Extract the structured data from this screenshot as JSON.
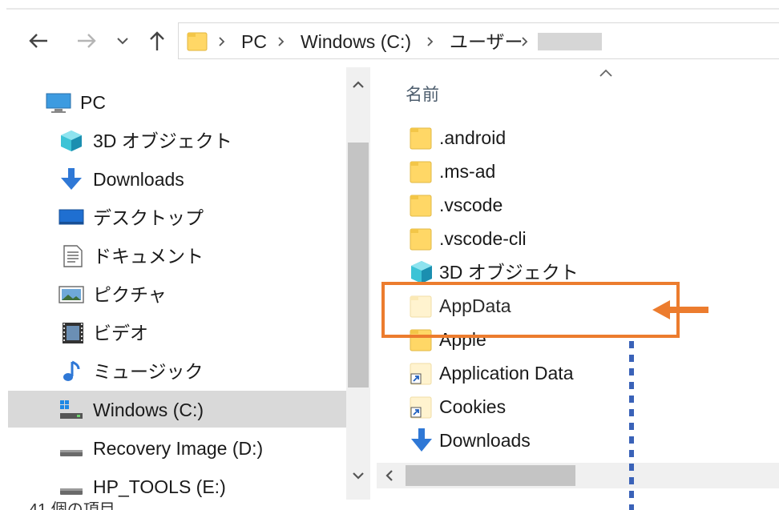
{
  "nav_buttons": {
    "back_icon": "arrow-left",
    "forward_icon": "arrow-right",
    "recent_icon": "chevron-down",
    "up_icon": "arrow-up"
  },
  "address": {
    "crumbs": [
      "PC",
      "Windows (C:)",
      "ユーザー"
    ]
  },
  "sidebar": {
    "items": [
      {
        "label": "PC",
        "icon": "pc-icon"
      },
      {
        "label": "3D オブジェクト",
        "icon": "3d-objects-icon"
      },
      {
        "label": "Downloads",
        "icon": "download-icon"
      },
      {
        "label": "デスクトップ",
        "icon": "desktop-icon"
      },
      {
        "label": "ドキュメント",
        "icon": "document-icon"
      },
      {
        "label": "ピクチャ",
        "icon": "picture-icon"
      },
      {
        "label": "ビデオ",
        "icon": "video-icon"
      },
      {
        "label": "ミュージック",
        "icon": "music-icon"
      },
      {
        "label": "Windows (C:)",
        "icon": "drive-icon",
        "selected": true
      },
      {
        "label": "Recovery Image (D:)",
        "icon": "drive-icon"
      },
      {
        "label": "HP_TOOLS (E:)",
        "icon": "drive-icon"
      }
    ]
  },
  "status": {
    "item_count": "41 個の項目"
  },
  "file_list": {
    "column_header": "名前",
    "rows": [
      {
        "label": ".android",
        "icon": "folder-icon"
      },
      {
        "label": ".ms-ad",
        "icon": "folder-icon"
      },
      {
        "label": ".vscode",
        "icon": "folder-icon"
      },
      {
        "label": ".vscode-cli",
        "icon": "folder-icon"
      },
      {
        "label": "3D オブジェクト",
        "icon": "3d-objects-icon"
      },
      {
        "label": "AppData",
        "icon": "hidden-folder-icon",
        "highlighted": true
      },
      {
        "label": "Apple",
        "icon": "folder-icon"
      },
      {
        "label": "Application Data",
        "icon": "shortcut-folder-icon"
      },
      {
        "label": "Cookies",
        "icon": "shortcut-folder-icon"
      },
      {
        "label": "Downloads",
        "icon": "download-icon"
      }
    ]
  },
  "colors": {
    "highlight": "#ec7c2e",
    "dotted_line": "#3a62b8",
    "folder": "#ffd766",
    "selected_row": "#d9d9d9"
  }
}
